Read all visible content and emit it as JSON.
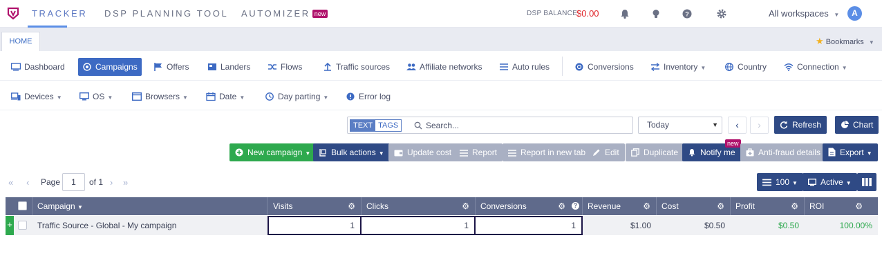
{
  "topnav": {
    "tracker": "TRACKER",
    "dsp": "DSP PLANNING TOOL",
    "automizer": "AUTOMIZER",
    "new_badge": "new",
    "dsp_balance_label": "DSP BALANCE",
    "dsp_balance_value": "$0.00",
    "workspaces": "All workspaces",
    "avatar": "A"
  },
  "tabs": {
    "home": "HOME",
    "bookmarks": "Bookmarks"
  },
  "nav_row1": [
    {
      "label": "Dashboard",
      "icon": "dashboard-icon"
    },
    {
      "label": "Campaigns",
      "icon": "target-icon",
      "active": true
    },
    {
      "label": "Offers",
      "icon": "flag-icon"
    },
    {
      "label": "Landers",
      "icon": "lander-icon"
    },
    {
      "label": "Flows",
      "icon": "shuffle-icon"
    },
    {
      "label": "Traffic sources",
      "icon": "upload-icon"
    },
    {
      "label": "Affiliate networks",
      "icon": "users-icon"
    },
    {
      "label": "Auto rules",
      "icon": "list-icon"
    },
    {
      "label": "Conversions",
      "icon": "coins-icon"
    },
    {
      "label": "Inventory",
      "icon": "exchange-icon"
    },
    {
      "label": "Country",
      "icon": "globe-icon"
    },
    {
      "label": "Connection",
      "icon": "wifi-icon"
    }
  ],
  "nav_row2": [
    {
      "label": "Devices",
      "icon": "devices-icon"
    },
    {
      "label": "OS",
      "icon": "monitor-icon"
    },
    {
      "label": "Browsers",
      "icon": "browser-icon"
    },
    {
      "label": "Date",
      "icon": "calendar-icon"
    },
    {
      "label": "Day parting",
      "icon": "clock-icon"
    },
    {
      "label": "Error log",
      "icon": "error-icon"
    }
  ],
  "search": {
    "mode_text": "TEXT",
    "mode_tags": "TAGS",
    "placeholder": "Search..."
  },
  "date_select": "Today",
  "buttons": {
    "refresh": "Refresh",
    "chart": "Chart",
    "new_campaign": "New campaign",
    "bulk_actions": "Bulk actions",
    "update_cost": "Update cost",
    "report": "Report",
    "report_new_tab": "Report in new tab",
    "edit": "Edit",
    "duplicate": "Duplicate",
    "notify_me": "Notify me",
    "notify_badge": "new",
    "anti_fraud": "Anti-fraud details",
    "export": "Export",
    "per_page": "100",
    "status": "Active"
  },
  "pager": {
    "page_label": "Page",
    "page_value": "1",
    "of_label": "of 1"
  },
  "table": {
    "headers": [
      "Campaign",
      "Visits",
      "Clicks",
      "Conversions",
      "Revenue",
      "Cost",
      "Profit",
      "ROI"
    ],
    "row": {
      "campaign": "Traffic Source - Global - My campaign",
      "visits": "1",
      "clicks": "1",
      "conversions": "1",
      "revenue": "$1.00",
      "cost": "$0.50",
      "profit": "$0.50",
      "roi": "100.00%"
    }
  },
  "colors": {
    "accent": "#3d6ac3",
    "navy": "#2f4a85",
    "green": "#2ea94e",
    "badge": "#b0126c",
    "red": "#e0252a"
  }
}
